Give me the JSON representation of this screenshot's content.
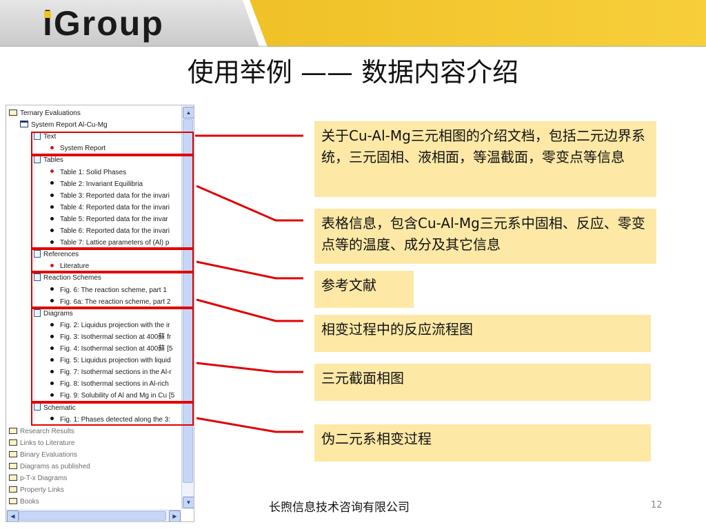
{
  "header": {
    "logo": "iGroup",
    "colors": {
      "grey_band": "#cfcfcf",
      "accent": "#f3c51c"
    }
  },
  "title": "使用举例 —— 数据内容介绍",
  "tree": {
    "items": [
      {
        "label": "Ternary Evaluations",
        "icon": "folder-icon"
      },
      {
        "label": "System Report Al-Cu-Mg",
        "icon": "book-icon"
      },
      {
        "label": "Text",
        "icon": "document-icon"
      },
      {
        "label": "System Report",
        "icon": "red-bullet-icon"
      },
      {
        "label": "Tables",
        "icon": "document-icon"
      },
      {
        "label": "Table 1: Solid Phases",
        "icon": "red-bullet-icon"
      },
      {
        "label": "Table 2: Invariant Equilibria",
        "icon": "bullet-icon"
      },
      {
        "label": "Table 3: Reported data for the invari",
        "icon": "bullet-icon"
      },
      {
        "label": "Table 4: Reported data for the invari",
        "icon": "bullet-icon"
      },
      {
        "label": "Table 5: Reported  data for the invar",
        "icon": "bullet-icon"
      },
      {
        "label": "Table 6: Reported data for the invari",
        "icon": "bullet-icon"
      },
      {
        "label": "Table 7: Lattice parameters of (Al) p",
        "icon": "bullet-icon"
      },
      {
        "label": "References",
        "icon": "document-icon"
      },
      {
        "label": "Literature",
        "icon": "red-bullet-icon"
      },
      {
        "label": "Reaction Schemes",
        "icon": "document-icon"
      },
      {
        "label": "Fig. 6: The reaction scheme, part 1",
        "icon": "bullet-icon"
      },
      {
        "label": "Fig. 6a: The reaction scheme, part 2",
        "icon": "bullet-icon"
      },
      {
        "label": "Diagrams",
        "icon": "document-icon"
      },
      {
        "label": "Fig. 2: Liquidus projection with the ir",
        "icon": "bullet-icon"
      },
      {
        "label": "Fig. 3: Isothermal section at 400蘇 fr",
        "icon": "bullet-icon"
      },
      {
        "label": "Fig. 4: Isothermal section at 400蘇 [5",
        "icon": "bullet-icon"
      },
      {
        "label": "Fig. 5: Liquidus projection with liquid",
        "icon": "bullet-icon"
      },
      {
        "label": "Fig. 7: Isothermal sections in the Al-r",
        "icon": "bullet-icon"
      },
      {
        "label": "Fig. 8: Isothermal sections in Al-rich",
        "icon": "bullet-icon"
      },
      {
        "label": "Fig. 9: Solubility of Al and Mg in Cu [5",
        "icon": "bullet-icon"
      },
      {
        "label": "Schematic",
        "icon": "document-icon"
      },
      {
        "label": "Fig. 1: Phases detected  along the 3:",
        "icon": "bullet-icon"
      },
      {
        "label": "Research  Results",
        "icon": "folder-icon"
      },
      {
        "label": "Links to Literature",
        "icon": "folder-icon"
      },
      {
        "label": "Binary Evaluations",
        "icon": "folder-icon"
      },
      {
        "label": "Diagrams as published",
        "icon": "folder-icon"
      },
      {
        "label": "p-T-x Diagrams",
        "icon": "folder-icon"
      },
      {
        "label": "Property Links",
        "icon": "folder-icon"
      },
      {
        "label": "Books",
        "icon": "folder-icon"
      }
    ]
  },
  "notes": [
    {
      "text": "关于Cu-Al-Mg三元相图的介绍文档，包括二元边界系统，三元固相、液相面，等温截面，零变点等信息"
    },
    {
      "text": "表格信息，包含Cu-Al-Mg三元系中固相、反应、零变点等的温度、成分及其它信息"
    },
    {
      "text": "参考文献"
    },
    {
      "text": "相变过程中的反应流程图"
    },
    {
      "text": "三元截面相图"
    },
    {
      "text": "伪二元系相变过程"
    }
  ],
  "footer": {
    "company": "长煦信息技术咨询有限公司",
    "page": "12"
  },
  "colors": {
    "highlight_red": "#e00000",
    "note_bg": "#fde8a6"
  }
}
